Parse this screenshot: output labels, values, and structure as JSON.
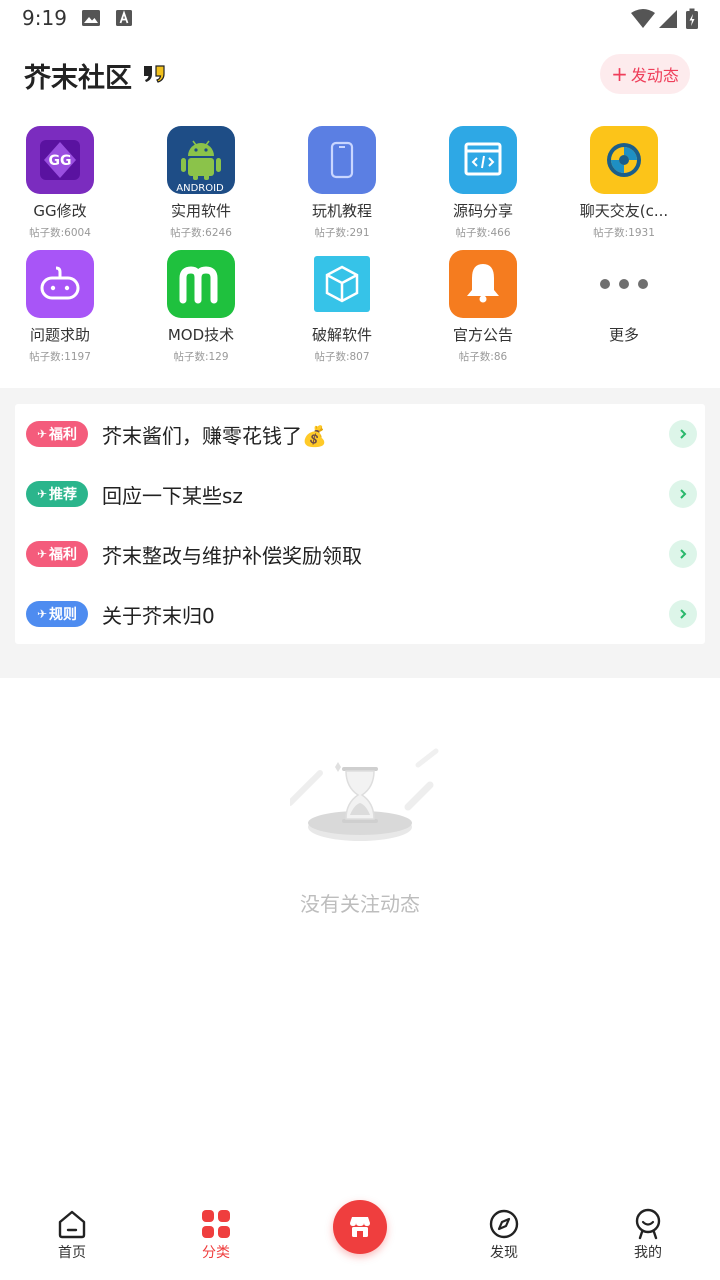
{
  "status_bar": {
    "time": "9:19"
  },
  "header": {
    "title": "芥末社区",
    "post_button": "发动态"
  },
  "categories": [
    {
      "name": "GG修改",
      "count": "帖子数:6004",
      "icon": "gg-icon",
      "color": "#7b2cbf"
    },
    {
      "name": "实用软件",
      "count": "帖子数:6246",
      "icon": "android-icon",
      "color": "#1e4d86"
    },
    {
      "name": "玩机教程",
      "count": "帖子数:291",
      "icon": "phone-icon",
      "color": "#5b7fe3"
    },
    {
      "name": "源码分享",
      "count": "帖子数:466",
      "icon": "code-icon",
      "color": "#2ea8e5"
    },
    {
      "name": "聊天交友(c...",
      "count": "帖子数:1931",
      "icon": "lifebuoy-icon",
      "color": "#fcc419"
    },
    {
      "name": "问题求助",
      "count": "帖子数:1197",
      "icon": "gamepad-icon",
      "color": "#a855f7"
    },
    {
      "name": "MOD技术",
      "count": "帖子数:129",
      "icon": "mod-icon",
      "color": "#1fc13e"
    },
    {
      "name": "破解软件",
      "count": "帖子数:807",
      "icon": "cube-icon",
      "color": "#36c3e8"
    },
    {
      "name": "官方公告",
      "count": "帖子数:86",
      "icon": "bell-icon",
      "color": "#f57c1f"
    },
    {
      "name": "更多",
      "count": "",
      "icon": "more-dots-icon",
      "color": "#6f6f6f"
    }
  ],
  "notices": [
    {
      "badge": "福利",
      "badge_color": "#f45c7c",
      "text": "芥末酱们，赚零花钱了💰"
    },
    {
      "badge": "推荐",
      "badge_color": "#2bb58c",
      "text": "回应一下某些sz"
    },
    {
      "badge": "福利",
      "badge_color": "#f45c7c",
      "text": "芥末整改与维护补偿奖励领取"
    },
    {
      "badge": "规则",
      "badge_color": "#4e8cf0",
      "text": "关于芥末归0"
    }
  ],
  "empty_state": {
    "text": "没有关注动态"
  },
  "bottom_nav": {
    "home": "首页",
    "category": "分类",
    "discover": "发现",
    "mine": "我的",
    "active": "分类",
    "active_color": "#ef3e3e"
  }
}
